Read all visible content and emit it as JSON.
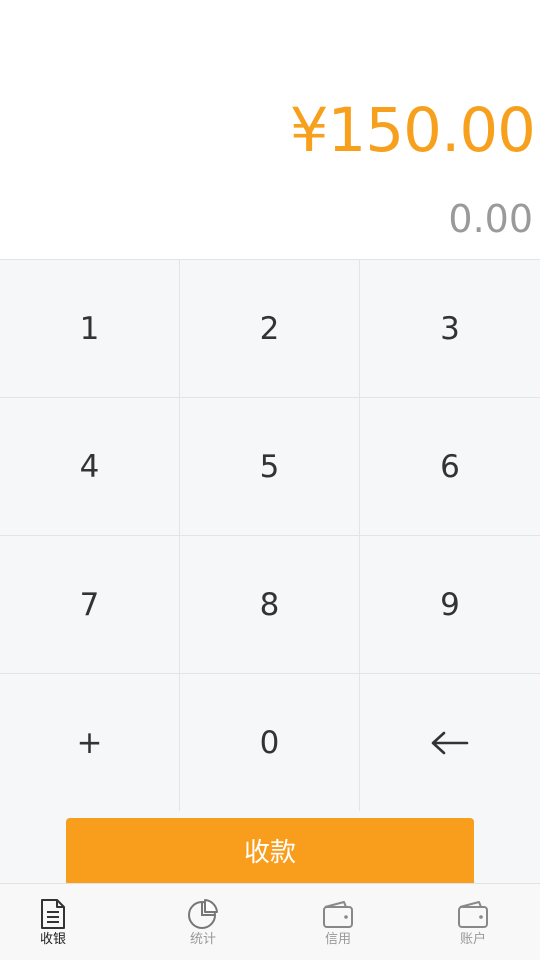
{
  "display": {
    "amount": "¥150.00",
    "current_input": "0.00"
  },
  "keypad": {
    "keys": [
      "1",
      "2",
      "3",
      "4",
      "5",
      "6",
      "7",
      "8",
      "9",
      "+",
      "0",
      "←"
    ]
  },
  "pay_button": {
    "label": "收款"
  },
  "tabbar": {
    "tabs": [
      {
        "label": "收银",
        "icon": "document-icon",
        "active": true
      },
      {
        "label": "统计",
        "icon": "pie-chart-icon",
        "active": false
      },
      {
        "label": "信用",
        "icon": "wallet-icon",
        "active": false
      },
      {
        "label": "账户",
        "icon": "wallet-icon",
        "active": false
      }
    ]
  },
  "colors": {
    "accent": "#f99d1c",
    "amount": "#f7a01d",
    "secondary_text": "#9a9a9a",
    "keypad_bg": "#f5f7f8"
  }
}
